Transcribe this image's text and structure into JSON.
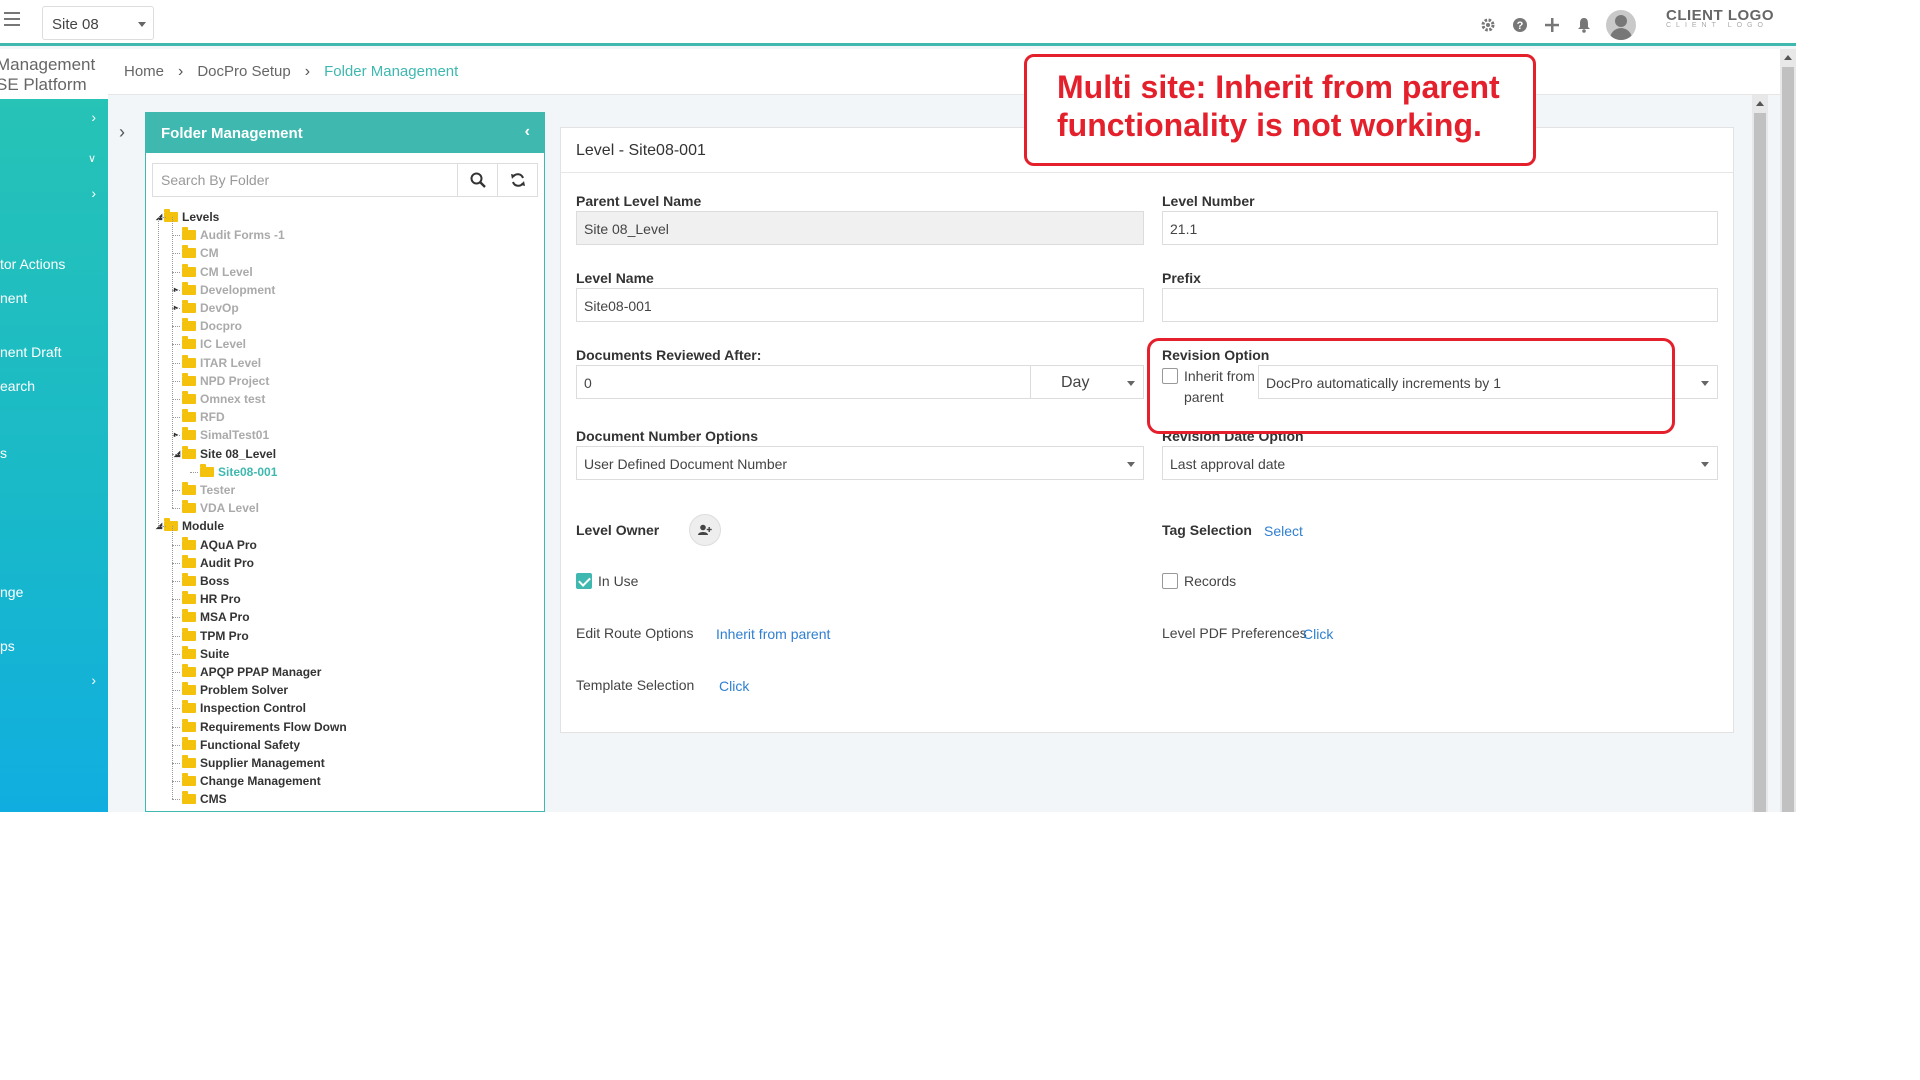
{
  "topbar": {
    "site": "Site 08",
    "client_logo": "CLIENT LOGO",
    "client_logo_sub": "CLIENT LOGO",
    "icons": [
      "gear-icon",
      "help-icon",
      "plus-icon",
      "bell-icon",
      "avatar"
    ]
  },
  "sidebar": {
    "app_title_line1": "Management",
    "app_title_line2": "SE Platform",
    "items": [
      {
        "label": "tor Actions"
      },
      {
        "label": "nent"
      },
      {
        "label": "nent Draft"
      },
      {
        "label": "earch"
      },
      {
        "label": "s"
      },
      {
        "label": "nge"
      },
      {
        "label": "ps"
      }
    ]
  },
  "breadcrumb": {
    "home": "Home",
    "setup": "DocPro Setup",
    "current": "Folder Management"
  },
  "tree_panel": {
    "title": "Folder Management",
    "search_placeholder": "Search By Folder",
    "levels_root": "Levels",
    "levels": [
      "Audit Forms -1",
      "CM",
      "CM Level",
      "Development",
      "DevOp",
      "Docpro",
      "IC Level",
      "ITAR Level",
      "NPD Project",
      "Omnex test",
      "RFD",
      "SimalTest01",
      "Site 08_Level",
      "Site08-001",
      "Tester",
      "VDA Level"
    ],
    "module_root": "Module",
    "modules": [
      "AQuA Pro",
      "Audit Pro",
      "Boss",
      "HR Pro",
      "MSA Pro",
      "TPM Pro",
      "Suite",
      "APQP PPAP Manager",
      "Problem Solver",
      "Inspection Control",
      "Requirements Flow Down",
      "Functional Safety",
      "Supplier Management",
      "Change Management",
      "CMS"
    ]
  },
  "form": {
    "title": "Level - Site08-001",
    "parent_level_name_label": "Parent Level Name",
    "parent_level_name": "Site 08_Level",
    "level_number_label": "Level Number",
    "level_number": "21.1",
    "level_name_label": "Level Name",
    "level_name": "Site08-001",
    "prefix_label": "Prefix",
    "prefix": "",
    "docs_reviewed_label": "Documents Reviewed After:",
    "docs_reviewed_value": "0",
    "docs_reviewed_unit": "Day",
    "revision_option_label": "Revision Option",
    "inherit_label_1": "Inherit from",
    "inherit_label_2": "parent",
    "revision_option_value": "DocPro automatically increments by 1",
    "doc_number_options_label": "Document Number Options",
    "doc_number_options_value": "User Defined Document Number",
    "revision_date_label": "Revision Date Option",
    "revision_date_value": "Last approval date",
    "level_owner_label": "Level Owner",
    "tag_selection_label": "Tag Selection",
    "tag_selection_link": "Select",
    "in_use_label": "In Use",
    "records_label": "Records",
    "edit_route_label": "Edit Route Options",
    "edit_route_link": "Inherit from parent",
    "pdf_pref_label": "Level PDF Preferences",
    "pdf_pref_link": "Click",
    "template_label": "Template Selection",
    "template_link": "Click"
  },
  "annotation": {
    "line1": "Multi site: Inherit from parent",
    "line2": "functionality is not working.",
    "color": "#e3202b"
  },
  "colors": {
    "accent": "#3fb8af",
    "link": "#2f7fd1"
  }
}
